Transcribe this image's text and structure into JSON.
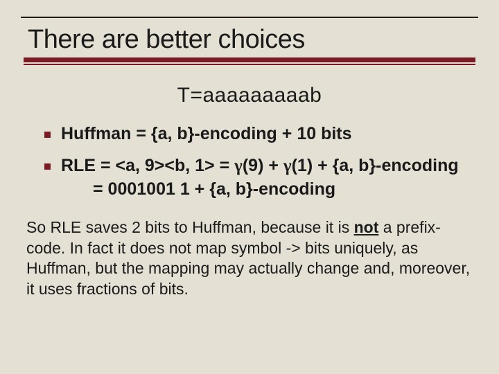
{
  "title": "There are better choices",
  "example": "T=aaaaaaaaab",
  "bullets": {
    "huffman": "Huffman = {a, b}-encoding + 10 bits",
    "rle_line1_pre": "RLE = <a, 9><b, 1> = ",
    "rle_gamma9": "γ",
    "rle_after_g9": "(9) + ",
    "rle_gamma1": "γ",
    "rle_after_g1": "(1) + {a, b}-encoding",
    "rle_line2": "= 0001001 1 + {a, b}-encoding"
  },
  "note": {
    "pre": "So RLE saves 2 bits to Huffman, because it is ",
    "not": "not",
    "post": " a prefix-code. In fact it does not map symbol -> bits uniquely, as Huffman, but the mapping may actually change and, moreover, it uses fractions of bits."
  }
}
